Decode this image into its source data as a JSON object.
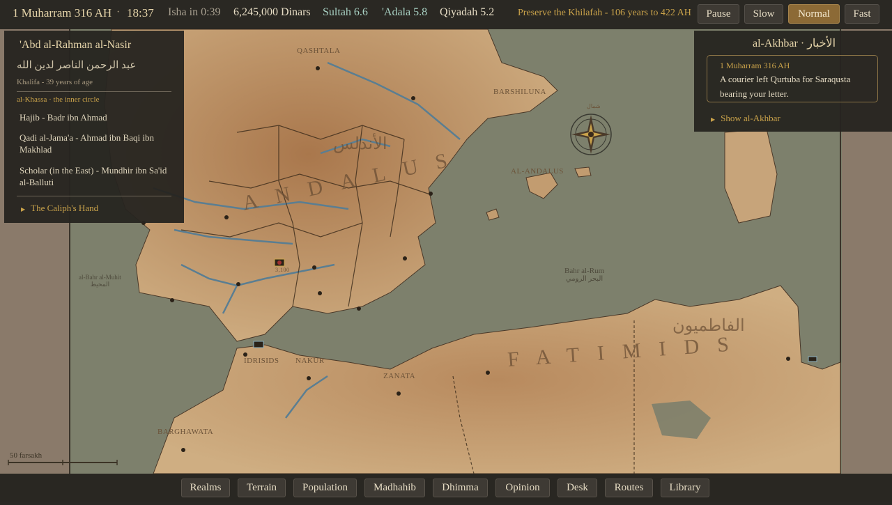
{
  "topbar": {
    "date": "1 Muharram 316 AH",
    "separator": "·",
    "time": "18:37",
    "prayer": "Isha in 0:39",
    "treasury": "6,245,000 Dinars",
    "sultah": "Sultah 6.6",
    "adala": "'Adala 5.8",
    "qiyadah": "Qiyadah 5.2",
    "goal": "Preserve the Khilafah - 106 years to 422 AH",
    "speeds": [
      {
        "label": "Pause",
        "active": false
      },
      {
        "label": "Slow",
        "active": false
      },
      {
        "label": "Normal",
        "active": true
      },
      {
        "label": "Fast",
        "active": false
      }
    ]
  },
  "ruler": {
    "name": "'Abd al-Rahman al-Nasir",
    "name_arabic": "عبد الرحمن الناصر لدين الله",
    "subtitle": "Khalifa - 39 years of age",
    "circle_title": "al-Khassa · the inner circle",
    "members": [
      "Hajib - Badr ibn Ahmad",
      "Qadi al-Jama'a - Ahmad ibn Baqi ibn Makhlad",
      "Scholar (in the East) - Mundhir ibn Sa'id al-Balluti"
    ],
    "hand_label": "The Caliph's Hand"
  },
  "news": {
    "title": "al-Akhbar · الأخبار",
    "entry_date": "1 Muharram 316 AH",
    "entry_text": "A courier left Qurtuba for Saraqusta bearing your letter.",
    "show_label": "Show al-Akhbar"
  },
  "map": {
    "labels": {
      "andalus": "ANDALUS",
      "andalus_arabic": "الأندلس",
      "al_andalus_small": "AL-ANDALUS",
      "fatimids": "FATIMIDS",
      "fatimids_arabic": "الفاطميون",
      "barshiluna": "BARSHILUNA",
      "qashtala": "QASHTALA",
      "idrisids": "IDRISIDS",
      "nakur": "NAKUR",
      "zanata": "ZANATA",
      "barghawata": "BARGHAWATA",
      "bahr_rum": "Bahr al-Rum",
      "bahr_rum_arabic": "البحر الرومي",
      "bahr_muhit": "al-Bahr al-Muhit",
      "bahr_muhit_arabic": "المحيط",
      "compass_arabic": "شمال",
      "army_count": "3,100"
    },
    "scale_label": "50 farsakh",
    "colors": {
      "sea": "#7d806c",
      "land_light": "#c9a57a",
      "land_dark": "#9a6e48",
      "river": "#5a7e92",
      "border": "#3a2a1a"
    }
  },
  "bottombar": {
    "tabs": [
      "Realms",
      "Terrain",
      "Population",
      "Madhahib",
      "Dhimma",
      "Opinion",
      "Desk",
      "Routes",
      "Library"
    ]
  }
}
